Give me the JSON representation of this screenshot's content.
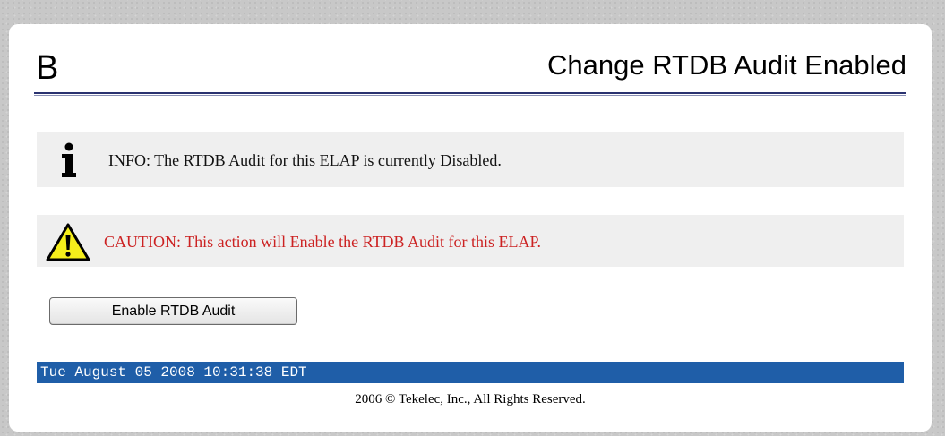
{
  "header": {
    "logo_letter": "B",
    "title": "Change RTDB Audit Enabled"
  },
  "info": {
    "icon": "info-icon",
    "text": "INFO: The RTDB Audit for this ELAP is currently Disabled."
  },
  "caution": {
    "icon": "warning-icon",
    "text": "CAUTION: This action will Enable the RTDB Audit for this ELAP.",
    "color": "#cc2222"
  },
  "action": {
    "button_label": "Enable RTDB Audit"
  },
  "status_bar": {
    "timestamp": "Tue August 05 2008 10:31:38 EDT",
    "color": "#1f5ea8"
  },
  "footer": {
    "copyright": "2006 © Tekelec, Inc., All Rights Reserved."
  }
}
